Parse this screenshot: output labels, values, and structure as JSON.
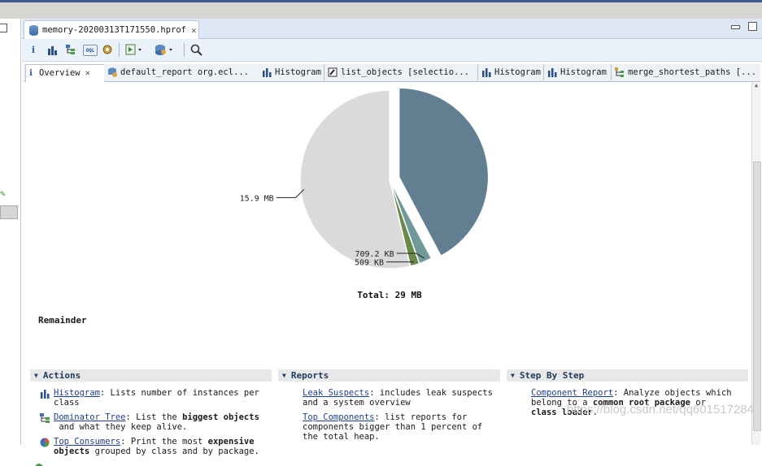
{
  "window": {
    "title": "memory-20200313T171550.hprof"
  },
  "editor_tab": {
    "label": "memory-20200313T171550.hprof",
    "close": "✕"
  },
  "toolbar": {
    "items": [
      "info-icon",
      "histogram-icon",
      "dominator-tree-icon",
      "oql-icon",
      "heap-dump-settings-icon",
      "run-report-icon",
      "query-browser-icon",
      "search-icon"
    ],
    "oql_label": "OQL"
  },
  "tabs": [
    {
      "label": "Overview",
      "close": "✕"
    },
    {
      "label": "default_report  org.ecl..."
    },
    {
      "label": "Histogram"
    },
    {
      "label": "list_objects  [selectio..."
    },
    {
      "label": "Histogram"
    },
    {
      "label": "Histogram"
    },
    {
      "label": "merge_shortest_paths  [..."
    }
  ],
  "chart_data": {
    "type": "pie",
    "slices": [
      {
        "label": "",
        "value": 12.5,
        "color": "#617f91",
        "exploded": true
      },
      {
        "label": "709.2 KB",
        "value": 0.69,
        "color": "#6f9a99"
      },
      {
        "label": "509 KB",
        "value": 0.5,
        "color": "#6a8a4a"
      },
      {
        "label": "15.9 MB",
        "value": 15.9,
        "color": "#dadada"
      }
    ],
    "total_label": "Total: 29 MB",
    "legend_label": "Remainder"
  },
  "panels": {
    "actions": {
      "title": "Actions",
      "items": [
        {
          "link": "Histogram",
          "pre": ": Lists number of instances per",
          "line2": "class"
        },
        {
          "link": "Dominator Tree",
          "pre": ": List the ",
          "bold": "biggest objects",
          "line2": "and what they keep alive."
        },
        {
          "link": "Top Consumers",
          "pre": ": Print the most ",
          "bold": "expensive",
          "line2_bold": "objects",
          "line2": " grouped by class and by package."
        }
      ]
    },
    "reports": {
      "title": "Reports",
      "items": [
        {
          "link": "Leak Suspects",
          "pre": ": includes leak suspects",
          "line2": "and a system overview"
        },
        {
          "link": "Top Components",
          "pre": ": list reports for",
          "line2": "components bigger than 1 percent of",
          "line3": "the total heap."
        }
      ]
    },
    "step": {
      "title": "Step By Step",
      "items": [
        {
          "link": "Component Report",
          "pre": ": Analyze objects which",
          "line2a": "belong to a ",
          "line2b": "common root package",
          "line2c": " or",
          "line3": "class loader",
          "line3b": "."
        }
      ]
    }
  },
  "watermark": "https://blog.csdn.net/qq601517284"
}
